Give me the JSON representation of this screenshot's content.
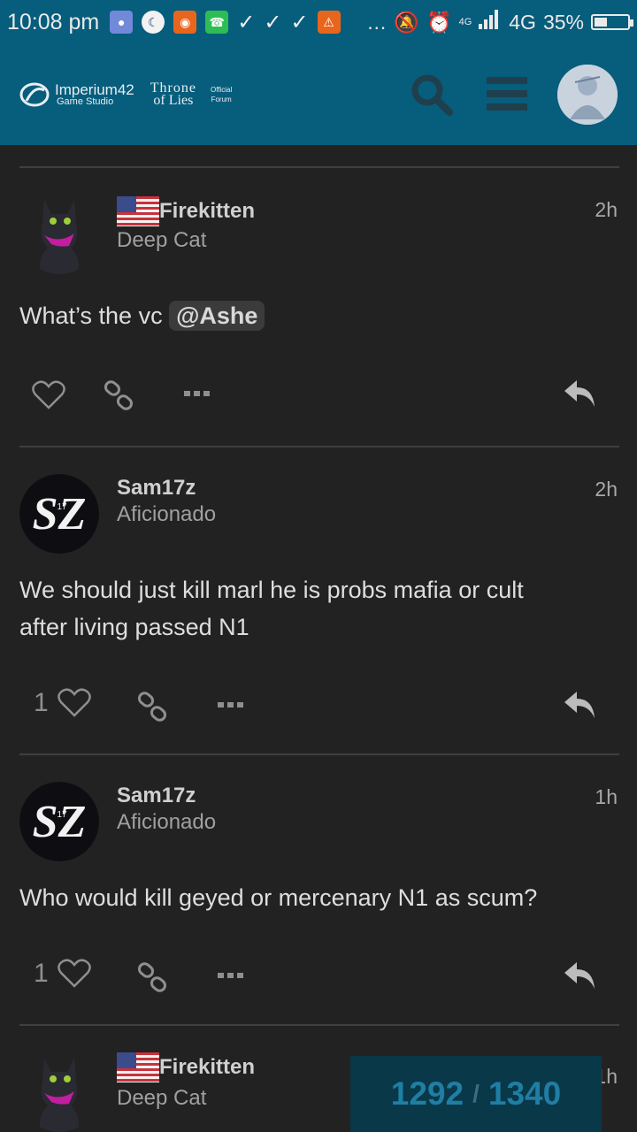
{
  "status_bar": {
    "time": "10:08 pm",
    "network": "4G",
    "network_small": "4G",
    "battery": "35%",
    "battery_level": 0.35,
    "overflow": "…"
  },
  "header": {
    "logo_imperium_name": "Imperium42",
    "logo_imperium_sub": "Game Studio",
    "logo_throne_line1": "Throne",
    "logo_throne_line2": "of Lies",
    "logo_official_line1": "Official",
    "logo_official_line2": "Forum"
  },
  "posts": [
    {
      "username": "Firekitten",
      "user_title": "Deep Cat",
      "age": "2h",
      "body_text": "What’s the vc ",
      "mention": "@Ashe",
      "likes": ""
    },
    {
      "username": "Sam17z",
      "user_title": "Aficionado",
      "age": "2h",
      "body_line1": "We should just kill marl he is probs mafia or cult",
      "body_line2": "after living passed N1",
      "likes": "1"
    },
    {
      "username": "Sam17z",
      "user_title": "Aficionado",
      "age": "1h",
      "body_text": "Who would kill geyed or mercenary N1 as scum?",
      "likes": "1"
    },
    {
      "username": "Firekitten",
      "user_title": "Deep Cat",
      "age": "1h"
    }
  ],
  "progress": {
    "current": "1292",
    "separator": "/",
    "total": "1340"
  },
  "colors": {
    "header_bg": "#075d7c",
    "page_bg": "#222222",
    "progress_bg": "#093849",
    "progress_text": "#1f7ea3"
  }
}
